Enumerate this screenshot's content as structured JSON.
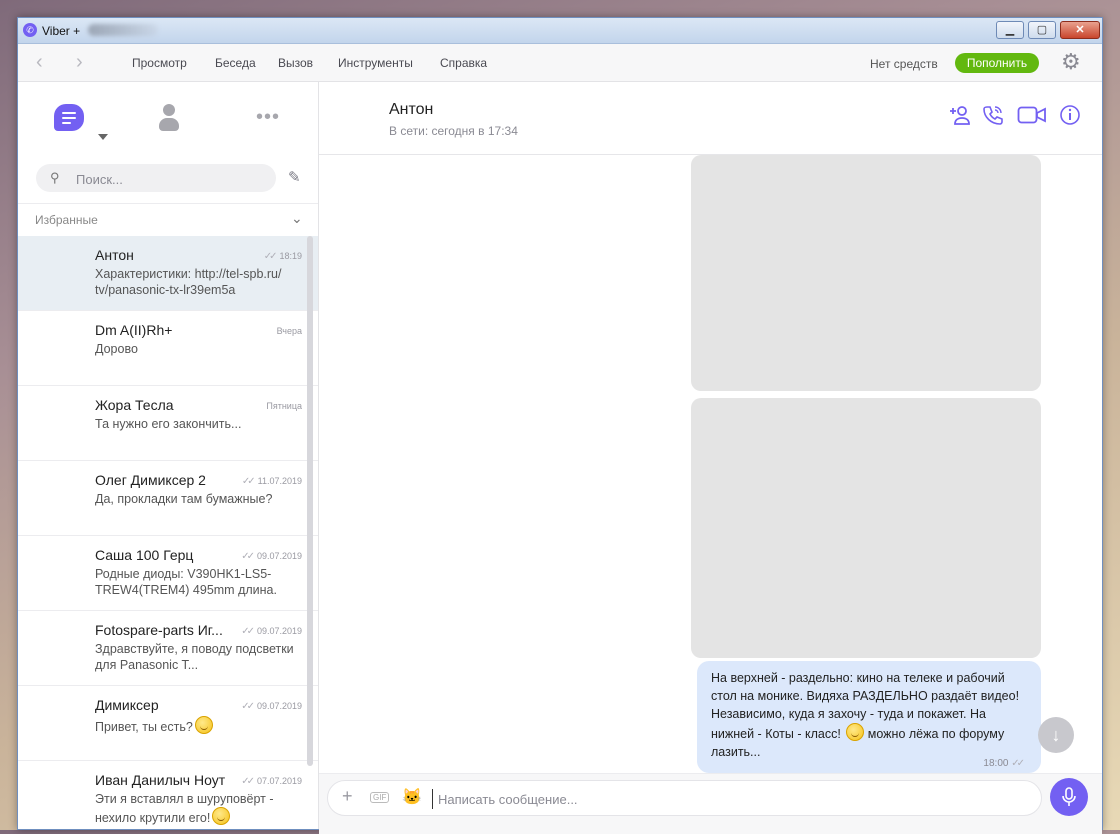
{
  "window": {
    "title": "Viber +",
    "minimize": "▁",
    "maximize": "▢",
    "close": "✕"
  },
  "menubar": {
    "items": [
      "Просмотр",
      "Беседа",
      "Вызов",
      "Инструменты",
      "Справка"
    ],
    "balance": "Нет средств",
    "topup_label": "Пополнить",
    "accent_green": "#62b80f"
  },
  "sidebar": {
    "search_placeholder": "Поиск...",
    "favorites_label": "Избранные",
    "chats": [
      {
        "name": "Антон",
        "preview": "Характеристики: http://tel-spb.ru/ tv/panasonic-tx-lr39em5a",
        "time": "18:19",
        "ticks": true,
        "active": true
      },
      {
        "name": "Dm A(II)Rh+",
        "preview": "Дорово",
        "time": "Вчера",
        "ticks": false
      },
      {
        "name": "Жора Тесла",
        "preview": "Та нужно его закончить...",
        "time": "Пятница",
        "ticks": false
      },
      {
        "name": "Олег Димиксер 2",
        "preview": "Да, прокладки там бумажные?",
        "time": "11.07.2019",
        "ticks": true
      },
      {
        "name": "Саша 100 Герц",
        "preview": "Родные диоды: V390HK1-LS5-TREW4(TREM4) 495mm длина.",
        "time": "09.07.2019",
        "ticks": true
      },
      {
        "name": "Fotospare-parts Иг...",
        "preview": "Здравствуйте, я поводу подсветки для Panasonic T...",
        "time": "09.07.2019",
        "ticks": true
      },
      {
        "name": "Димиксер",
        "preview": "Привет, ты есть?",
        "time": "09.07.2019",
        "ticks": true,
        "emoji": true
      },
      {
        "name": "Иван Данилыч Ноут",
        "preview": "Эти я вставлял в шуруповёрт - нехило крутили его!",
        "time": "07.07.2019",
        "ticks": true,
        "emoji": true
      }
    ]
  },
  "conversation": {
    "contact_name": "Антон",
    "status": "В сети: сегодня в 17:34",
    "accent": "#7360f2",
    "message": {
      "text_part1": "На верхней - раздельно: кино на телеке и рабочий стол на монике. Видяха РАЗДЕЛЬНО раздаёт видео! Независимо, куда я захочу - туда и покажет. На нижней - Коты - класс!",
      "text_part2": "можно лёжа по форуму лазить...",
      "time": "18:00"
    },
    "composer_placeholder": "Написать сообщение...",
    "gif_label": "GIF"
  }
}
